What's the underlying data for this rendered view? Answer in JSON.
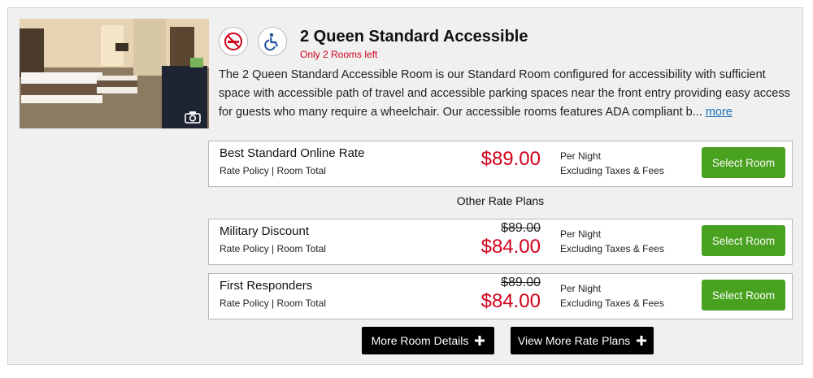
{
  "room": {
    "title": "2 Queen Standard Accessible",
    "availability": "Only 2 Rooms left",
    "description": "The 2 Queen Standard Accessible Room is our Standard Room configured for accessibility with sufficient space with accessible path of travel and accessible parking spaces near the front entry providing easy access for guests who many require a wheelchair. Our accessible rooms features ADA compliant b...",
    "more_link": "more",
    "amenity_icons": [
      "no-smoking-icon",
      "wheelchair-accessible-icon"
    ],
    "photo_icon": "camera-icon"
  },
  "rates": [
    {
      "name": "Best Standard Online Rate",
      "policy": "Rate Policy | Room Total",
      "price": "$89.00",
      "per_night": "Per Night",
      "taxes": "Excluding Taxes & Fees",
      "button": "Select Room"
    },
    {
      "name": "Military Discount",
      "policy": "Rate Policy | Room Total",
      "original_price": "$89.00",
      "price": "$84.00",
      "per_night": "Per Night",
      "taxes": "Excluding Taxes & Fees",
      "button": "Select Room"
    },
    {
      "name": "First Responders",
      "policy": "Rate Policy | Room Total",
      "original_price": "$89.00",
      "price": "$84.00",
      "per_night": "Per Night",
      "taxes": "Excluding Taxes & Fees",
      "button": "Select Room"
    }
  ],
  "other_rate_plans_label": "Other Rate Plans",
  "actions": {
    "more_details": "More Room Details",
    "more_rates": "View More Rate Plans"
  },
  "colors": {
    "price_red": "#d0021b",
    "select_green": "#48a11f",
    "link_blue": "#1a6fb5"
  }
}
